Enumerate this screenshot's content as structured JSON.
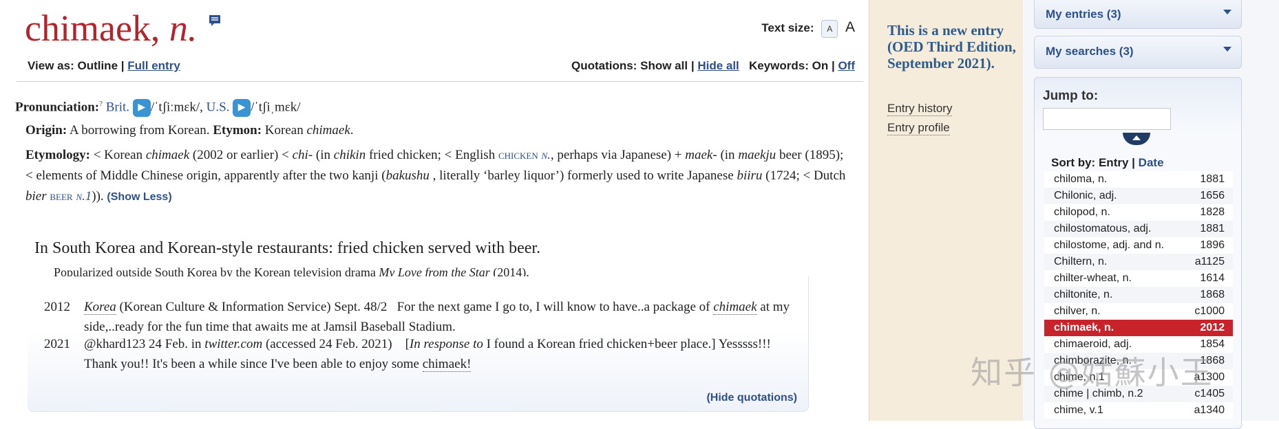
{
  "entry": {
    "headword": "chimaek,",
    "pos": "n.",
    "text_size_label": "Text size:",
    "text_size_small": "A",
    "text_size_large": "A",
    "view_as_label": "View as:",
    "view_outline": "Outline",
    "view_sep": "|",
    "view_full": "Full entry",
    "quotations_label": "Quotations:",
    "quotations_show": "Show all",
    "quotations_sep": "|",
    "quotations_hide": "Hide all",
    "keywords_label": "Keywords:",
    "keywords_on": "On",
    "keywords_sep": "|",
    "keywords_off": "Off"
  },
  "pronunciation": {
    "label": "Pronunciation:",
    "help": "?",
    "brit_label": "Brit.",
    "brit_ipa": "/ˈtʃiːmɛk/,",
    "us_label": "U.S.",
    "us_ipa": "/ˈtʃiˌmɛk/"
  },
  "origin": {
    "origin_label": "Origin:",
    "origin_text": "A borrowing from Korean.",
    "etymon_label": "Etymon:",
    "etymon_text": "Korean",
    "etymon_word": "chimaek",
    "etymon_end": "."
  },
  "etymology": {
    "label": "Etymology:",
    "p1": "< Korean",
    "w1": "chimaek",
    "p2": "(2002 or earlier) <",
    "w2": "chi-",
    "p3": "(in",
    "w3": "chikin",
    "p4": "fried chicken; < English",
    "x1": "chicken",
    "x1pos": "n.",
    "p5": ", perhaps via Japanese) +",
    "w4": "maek-",
    "p6": "(in",
    "w5": "maekju",
    "p7": "beer (1895); < elements of Middle Chinese origin, apparently after the two kanji (",
    "w6": "bakushu",
    "p8": ", literally ‘barley liquor’) formerly used to write Japanese",
    "w7": "biiru",
    "p9": "(1724; < Dutch",
    "w8": "bier",
    "x2": "beer",
    "x2pos": "n.1",
    "p10": ")).",
    "show_less": "(Show Less)"
  },
  "sense": {
    "definition": "In South Korea and Korean-style restaurants: fried chicken served with beer.",
    "note_pre": "Popularized outside South Korea by the Korean television drama",
    "note_title": "My Love from the Star",
    "note_post": "(2014)."
  },
  "quotations": [
    {
      "year": "2012",
      "source": "Korea",
      "pub": "(Korean Culture & Information Service) Sept. 48/2",
      "text1": "For the next game I go to, I will know to have..a package of",
      "kw": "chimaek",
      "text2": "at my side,..ready for the fun time that awaits me at Jamsil Baseball Stadium."
    },
    {
      "year": "2021",
      "source_pre": "@khard123 24 Feb. in",
      "source": "twitter.com",
      "pub": "(accessed 24 Feb. 2021)",
      "resp": "In response to",
      "text1": "I found a Korean fried chicken+beer place.]",
      "text2_pre": "Yesssss!!! Thank you!! It's been a while since I've been able to enjoy some",
      "kw": "chimaek!"
    }
  ],
  "hide_quotations": "(Hide quotations)",
  "middle": {
    "new_entry": "This is a new entry (OED Third Edition, September 2021).",
    "entry_history": "Entry history",
    "entry_profile": "Entry profile"
  },
  "sidebar": {
    "my_entries": "My entries (3)",
    "my_searches": "My searches (3)",
    "jump_to": "Jump to:",
    "sort_label": "Sort by:",
    "sort_entry": "Entry",
    "sort_sep": "|",
    "sort_date": "Date",
    "list": [
      {
        "word": "chiloma, n.",
        "year": "1881"
      },
      {
        "word": "Chilonic, adj.",
        "year": "1656"
      },
      {
        "word": "chilopod, n.",
        "year": "1828"
      },
      {
        "word": "chilostomatous, adj.",
        "year": "1881"
      },
      {
        "word": "chilostome, adj. and n.",
        "year": "1896"
      },
      {
        "word": "Chiltern, n.",
        "year": "a1125"
      },
      {
        "word": "chilter-wheat, n.",
        "year": "1614"
      },
      {
        "word": "chiltonite, n.",
        "year": "1868"
      },
      {
        "word": "chilver, n.",
        "year": "c1000"
      },
      {
        "word": "chimaek, n.",
        "year": "2012"
      },
      {
        "word": "chimaeroid, adj.",
        "year": "1854"
      },
      {
        "word": "chimborazite, n.",
        "year": "1868"
      },
      {
        "word": "chime, n.1",
        "year": "a1300"
      },
      {
        "word": "chime | chimb, n.2",
        "year": "c1405"
      },
      {
        "word": "chime, v.1",
        "year": "a1340"
      }
    ]
  },
  "watermark": "知乎 @姑蘇小王",
  "colors": {
    "headword": "#b5232b",
    "link": "#2d4f8a",
    "active_row": "#c8232b",
    "new_entry": "#2d5b8c"
  }
}
